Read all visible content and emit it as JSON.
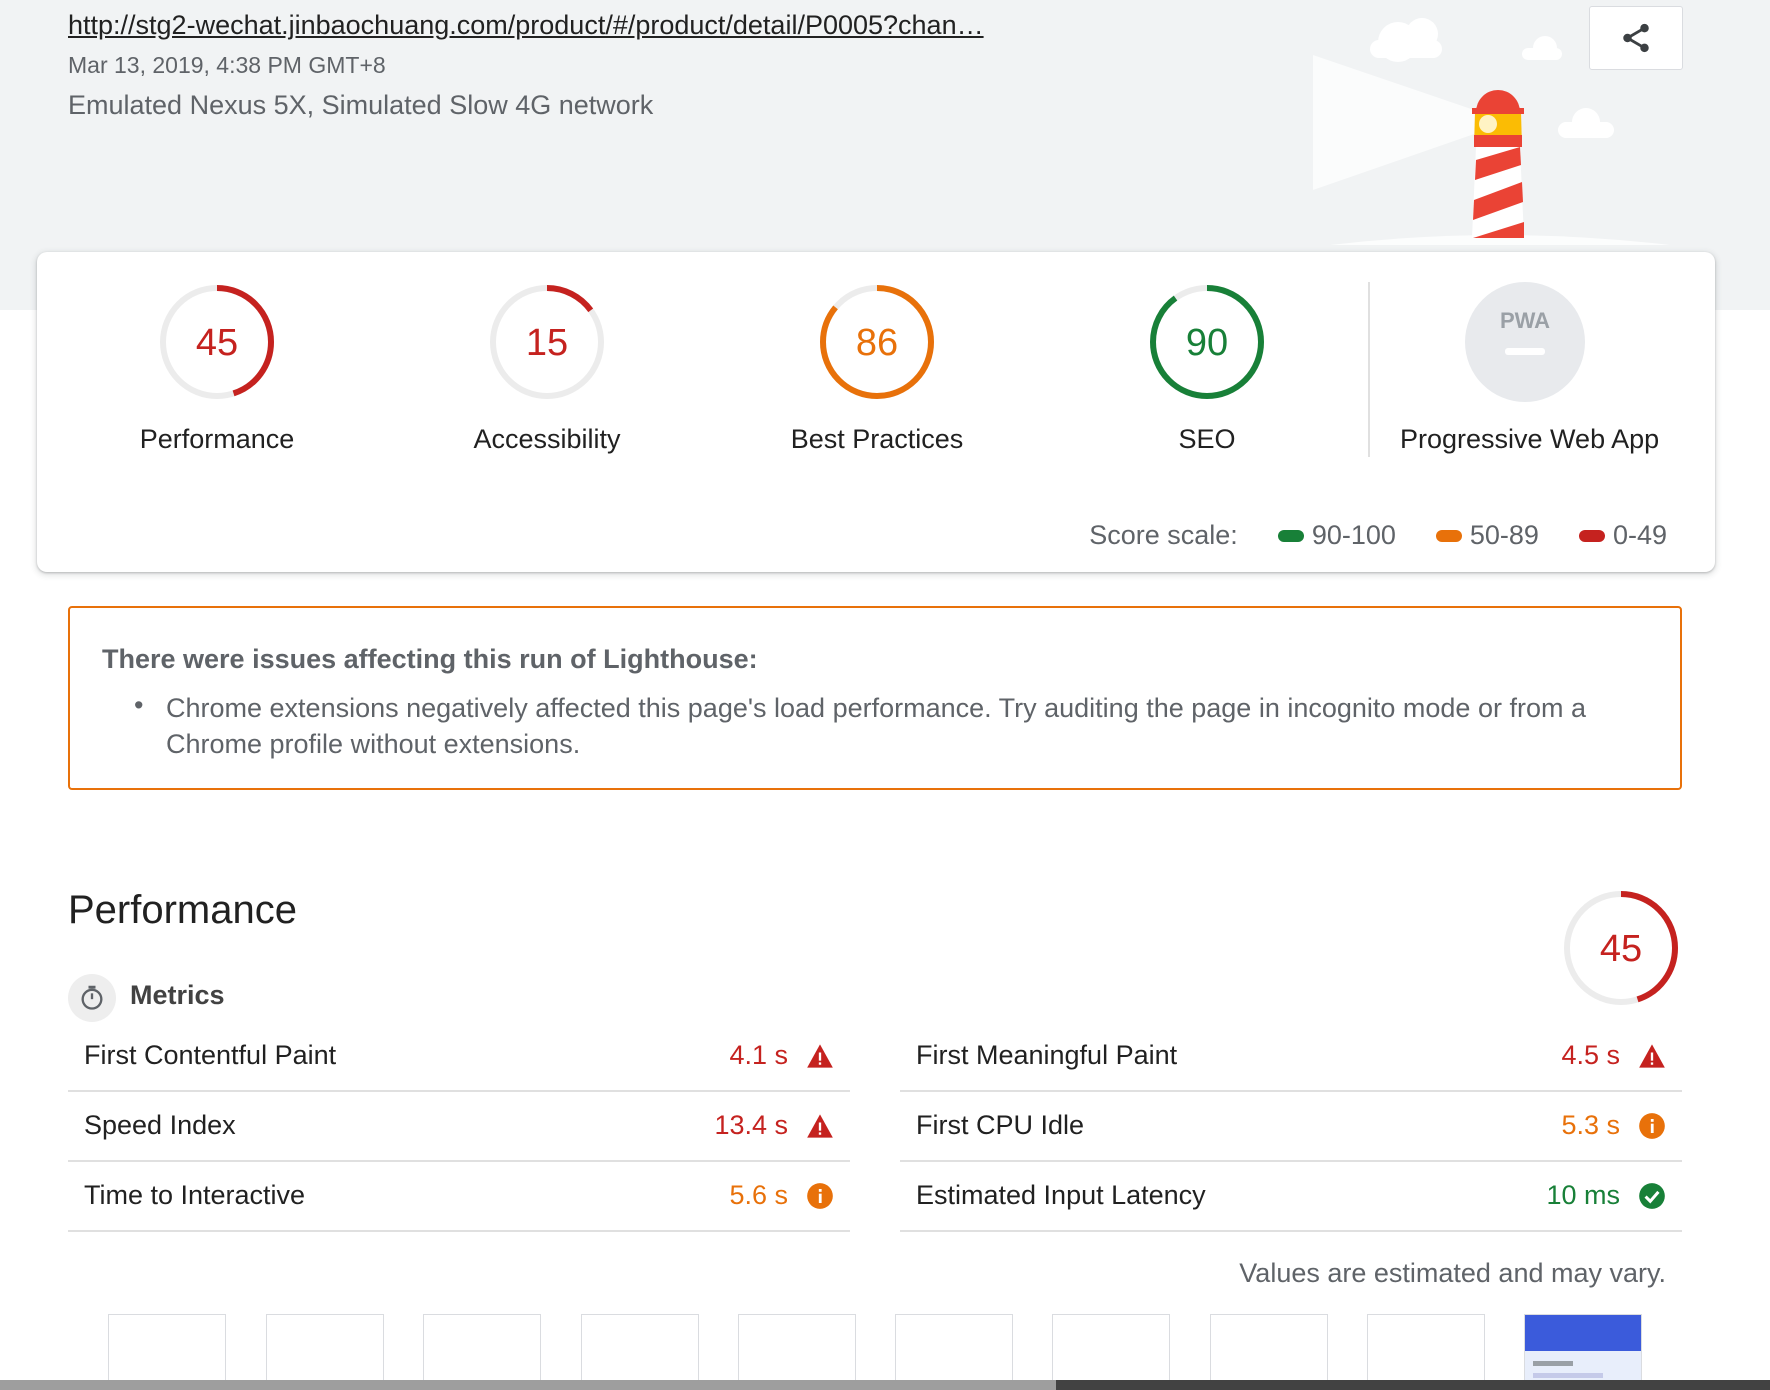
{
  "header": {
    "url": "http://stg2-wechat.jinbaochuang.com/product/#/product/detail/P0005?chan…",
    "date": "Mar 13, 2019, 4:38 PM GMT+8",
    "environment": "Emulated Nexus 5X, Simulated Slow 4G network",
    "share_icon": "share-icon"
  },
  "scores": {
    "categories": [
      {
        "label": "Performance",
        "score": "45",
        "fraction": 0.45,
        "color": "#c5221f"
      },
      {
        "label": "Accessibility",
        "score": "15",
        "fraction": 0.15,
        "color": "#c5221f"
      },
      {
        "label": "Best Practices",
        "score": "86",
        "fraction": 0.86,
        "color": "#e8710a"
      },
      {
        "label": "SEO",
        "score": "90",
        "fraction": 0.9,
        "color": "#188038"
      }
    ],
    "pwa": {
      "label": "Progressive Web App",
      "badge": "PWA"
    },
    "scale": {
      "label": "Score scale:",
      "ranges": [
        {
          "range": "90-100",
          "color": "#188038"
        },
        {
          "range": "50-89",
          "color": "#e8710a"
        },
        {
          "range": "0-49",
          "color": "#c5221f"
        }
      ]
    }
  },
  "warnings": {
    "title": "There were issues affecting this run of Lighthouse:",
    "items": [
      "Chrome extensions negatively affected this page's load performance. Try auditing the page in incognito mode or from a Chrome profile without extensions."
    ]
  },
  "performance": {
    "title": "Performance",
    "score": "45",
    "fraction": 0.45,
    "metrics_heading": "Metrics",
    "metrics": [
      {
        "label": "First Contentful Paint",
        "value": "4.1 s",
        "status": "fail",
        "icon": "warning-icon"
      },
      {
        "label": "First Meaningful Paint",
        "value": "4.5 s",
        "status": "fail",
        "icon": "warning-icon"
      },
      {
        "label": "Speed Index",
        "value": "13.4 s",
        "status": "fail",
        "icon": "warning-icon"
      },
      {
        "label": "First CPU Idle",
        "value": "5.3 s",
        "status": "average",
        "icon": "info-icon"
      },
      {
        "label": "Time to Interactive",
        "value": "5.6 s",
        "status": "average",
        "icon": "info-icon"
      },
      {
        "label": "Estimated Input Latency",
        "value": "10 ms",
        "status": "pass",
        "icon": "check-icon"
      }
    ],
    "note": "Values are estimated and may vary."
  },
  "colors": {
    "fail": "#c5221f",
    "average": "#e8710a",
    "pass": "#188038",
    "background": "#f1f3f4"
  }
}
